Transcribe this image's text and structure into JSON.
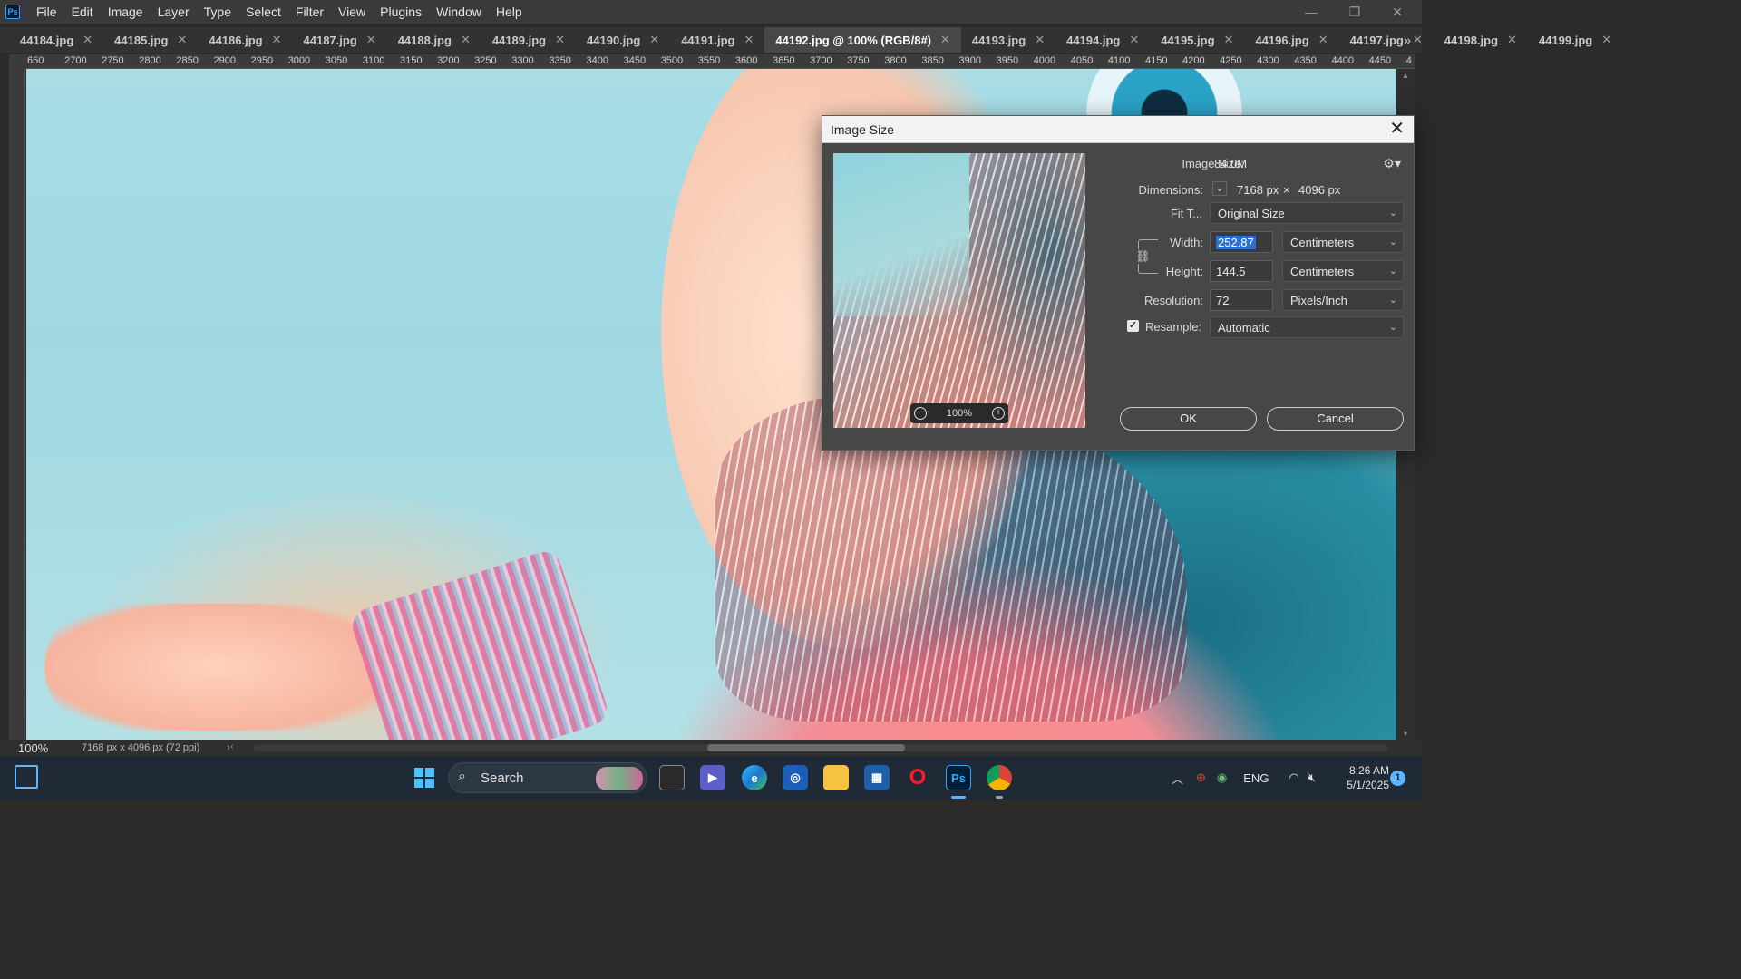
{
  "app": {
    "logo": "Ps",
    "menu": [
      "File",
      "Edit",
      "Image",
      "Layer",
      "Type",
      "Select",
      "Filter",
      "View",
      "Plugins",
      "Window",
      "Help"
    ]
  },
  "tabs": [
    {
      "label": "44184.jpg",
      "active": false
    },
    {
      "label": "44185.jpg",
      "active": false
    },
    {
      "label": "44186.jpg",
      "active": false
    },
    {
      "label": "44187.jpg",
      "active": false
    },
    {
      "label": "44188.jpg",
      "active": false
    },
    {
      "label": "44189.jpg",
      "active": false
    },
    {
      "label": "44190.jpg",
      "active": false
    },
    {
      "label": "44191.jpg",
      "active": false
    },
    {
      "label": "44192.jpg @ 100% (RGB/8#)",
      "active": true
    },
    {
      "label": "44193.jpg",
      "active": false
    },
    {
      "label": "44194.jpg",
      "active": false
    },
    {
      "label": "44195.jpg",
      "active": false
    },
    {
      "label": "44196.jpg",
      "active": false
    },
    {
      "label": "44197.jpg",
      "active": false
    },
    {
      "label": "44198.jpg",
      "active": false
    },
    {
      "label": "44199.jpg",
      "active": false
    }
  ],
  "tab_overflow": "»",
  "ruler_h": [
    "650",
    "2700",
    "2750",
    "2800",
    "2850",
    "2900",
    "2950",
    "3000",
    "3050",
    "3100",
    "3150",
    "3200",
    "3250",
    "3300",
    "3350",
    "3400",
    "3450",
    "3500",
    "3550",
    "3600",
    "3650",
    "3700",
    "3750",
    "3800",
    "3850",
    "3900",
    "3950",
    "4000",
    "4050",
    "4100",
    "4150",
    "4200",
    "4250",
    "4300",
    "4350",
    "4400",
    "4450",
    "4"
  ],
  "status": {
    "zoom": "100%",
    "doc_info": "7168 px x 4096 px (72 ppi)"
  },
  "dialog": {
    "title": "Image Size",
    "image_size_label": "Image Size:",
    "image_size_value": "84.0M",
    "dimensions_label": "Dimensions:",
    "dim_width": "7168 px",
    "dim_x": "×",
    "dim_height": "4096 px",
    "fit_label": "Fit T...",
    "fit_value": "Original Size",
    "width_label": "Width:",
    "width_value": "252.87",
    "width_unit": "Centimeters",
    "height_label": "Height:",
    "height_value": "144.5",
    "height_unit": "Centimeters",
    "resolution_label": "Resolution:",
    "resolution_value": "72",
    "resolution_unit": "Pixels/Inch",
    "resample_label": "Resample:",
    "resample_checked": true,
    "resample_value": "Automatic",
    "preview_zoom": "100%",
    "ok_label": "OK",
    "cancel_label": "Cancel"
  },
  "taskbar": {
    "search_label": "Search",
    "tray_language": "ENG",
    "time": "8:26 AM",
    "date": "5/1/2025",
    "notification_count": "1"
  }
}
